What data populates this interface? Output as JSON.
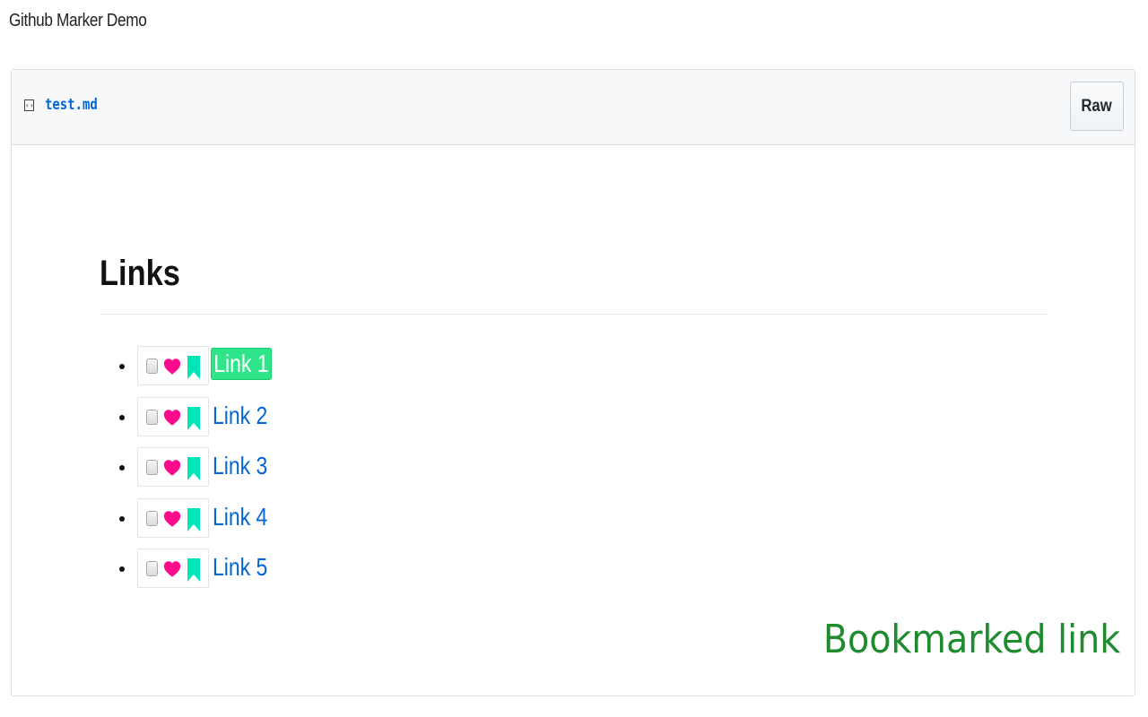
{
  "page": {
    "title": "Github Marker Demo"
  },
  "file": {
    "icon": "code-file-icon",
    "name": "test.md",
    "raw_label": "Raw"
  },
  "content": {
    "heading": "Links",
    "links": [
      {
        "label": "Link 1",
        "highlighted": true
      },
      {
        "label": "Link 2",
        "highlighted": false
      },
      {
        "label": "Link 3",
        "highlighted": false
      },
      {
        "label": "Link 4",
        "highlighted": false
      },
      {
        "label": "Link 5",
        "highlighted": false
      }
    ],
    "marker_icons": [
      "checkbox",
      "heart-icon",
      "bookmark-icon"
    ],
    "bookmarked_note": "Bookmarked link"
  },
  "colors": {
    "link": "#0366d6",
    "heart": "#ff0a8c",
    "bookmark": "#00e6b8",
    "highlight_bg": "#2ee58a",
    "bookmarked_note": "#1e8c2e"
  }
}
